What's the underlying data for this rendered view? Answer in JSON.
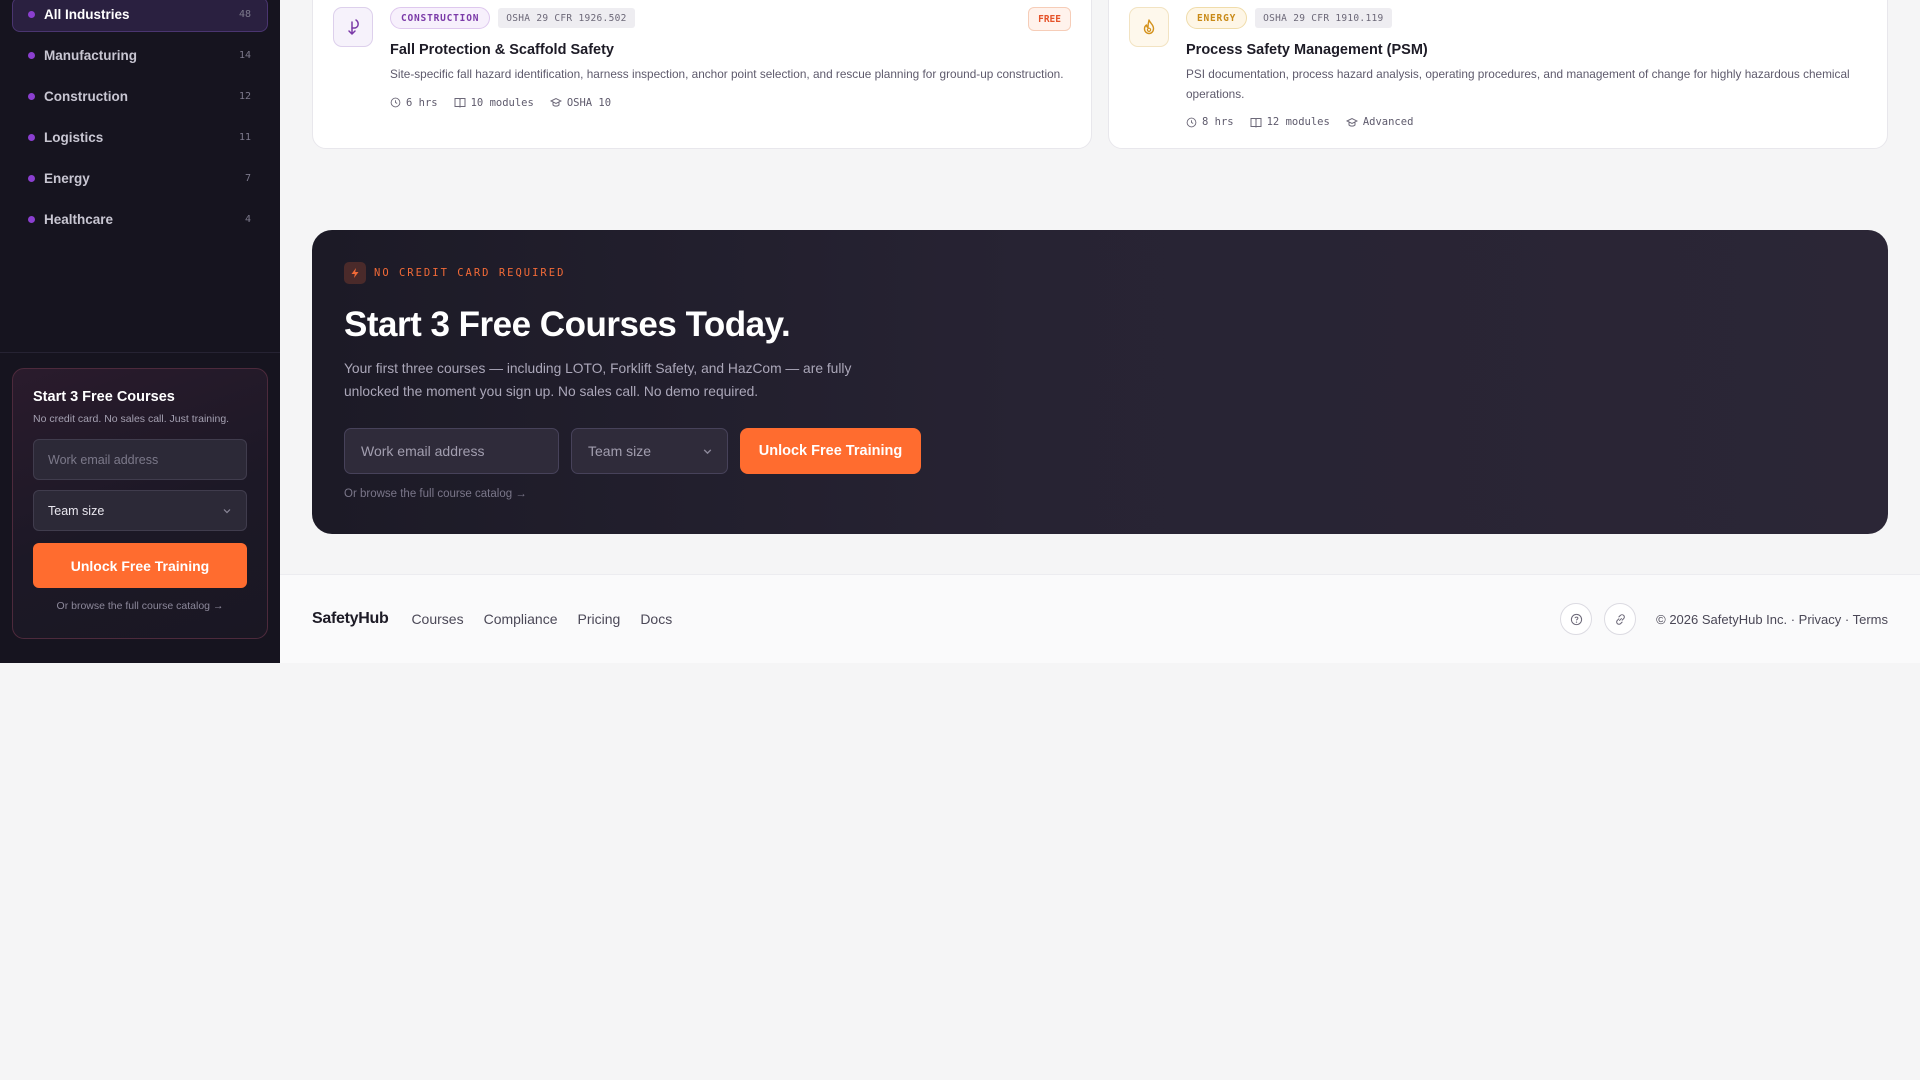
{
  "sidebar": {
    "industries": [
      {
        "label": "All Industries",
        "count": "48"
      },
      {
        "label": "Manufacturing",
        "count": "14"
      },
      {
        "label": "Construction",
        "count": "12"
      },
      {
        "label": "Logistics",
        "count": "11"
      },
      {
        "label": "Energy",
        "count": "7"
      },
      {
        "label": "Healthcare",
        "count": "4"
      }
    ],
    "promo": {
      "title": "Start 3 Free Courses",
      "subtitle": "No credit card. No sales call. Just training.",
      "email_placeholder": "Work email address",
      "team_size": "Team size",
      "button": "Unlock Free Training",
      "browse_link": "Or browse the full course catalog →"
    }
  },
  "courses": [
    {
      "category": "CONSTRUCTION",
      "regulation": "OSHA 29 CFR 1926.502",
      "badge": "FREE",
      "title": "Fall Protection & Scaffold Safety",
      "description": "Site-specific fall hazard identification, harness inspection, anchor point selection, and rescue planning for ground-up construction.",
      "duration": "6 hrs",
      "modules": "10 modules",
      "level": "OSHA 10"
    },
    {
      "category": "ENERGY",
      "regulation": "OSHA 29 CFR 1910.119",
      "title": "Process Safety Management (PSM)",
      "description": "PSI documentation, process hazard analysis, operating procedures, and management of change for highly hazardous chemical operations.",
      "duration": "8 hrs",
      "modules": "12 modules",
      "level": "Advanced"
    }
  ],
  "cta": {
    "badge": "NO CREDIT CARD REQUIRED",
    "title": "Start 3 Free Courses Today.",
    "description": "Your first three courses — including LOTO, Forklift Safety, and HazCom — are fully unlocked the moment you sign up. No sales call. No demo required.",
    "email_placeholder": "Work email address",
    "team_size": "Team size",
    "button": "Unlock Free Training",
    "browse_link": "Or browse the full course catalog →"
  },
  "footer": {
    "logo": "SafetyHub",
    "nav": [
      "Courses",
      "Compliance",
      "Pricing",
      "Docs"
    ],
    "copyright": "© 2026 SafetyHub Inc. · Privacy · Terms"
  },
  "colors": {
    "accent": "#ff6c2f",
    "sidebar_bg": "#16141f",
    "industry_dot": "#8b3fd0"
  }
}
